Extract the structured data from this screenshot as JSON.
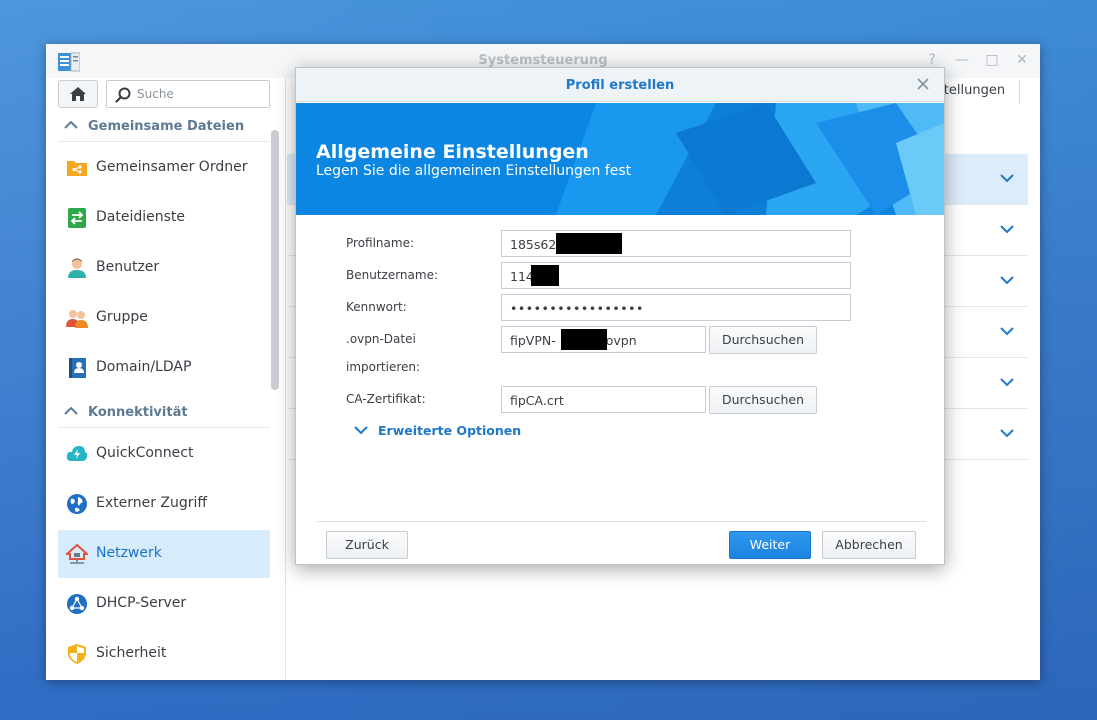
{
  "window": {
    "title": "Systemsteuerung",
    "controls": [
      "?",
      "—",
      "□",
      "✕"
    ]
  },
  "sidebar": {
    "search_placeholder": "Suche",
    "sections": [
      {
        "label": "Gemeinsame Dateien",
        "items": [
          {
            "label": "Gemeinsamer Ordner",
            "icon": "shared-folder-icon"
          },
          {
            "label": "Dateidienste",
            "icon": "file-services-icon"
          },
          {
            "label": "Benutzer",
            "icon": "user-icon"
          },
          {
            "label": "Gruppe",
            "icon": "group-icon"
          },
          {
            "label": "Domain/LDAP",
            "icon": "domain-ldap-icon"
          }
        ]
      },
      {
        "label": "Konnektivität",
        "items": [
          {
            "label": "QuickConnect",
            "icon": "quickconnect-icon"
          },
          {
            "label": "Externer Zugriff",
            "icon": "external-access-icon"
          },
          {
            "label": "Netzwerk",
            "icon": "network-icon",
            "active": true
          },
          {
            "label": "DHCP-Server",
            "icon": "dhcp-server-icon"
          },
          {
            "label": "Sicherheit",
            "icon": "security-icon"
          }
        ]
      }
    ]
  },
  "content": {
    "tab_partial": "stellungen"
  },
  "dialog": {
    "title": "Profil erstellen",
    "banner_title": "Allgemeine Einstellungen",
    "banner_subtitle": "Legen Sie die allgemeinen Einstellungen fest",
    "fields": {
      "profile_name": {
        "label": "Profilname:",
        "value": "185s62"
      },
      "username": {
        "label": "Benutzername:",
        "value": "114"
      },
      "password": {
        "label": "Kennwort:",
        "value": "•••••••••••••••••"
      },
      "ovpn": {
        "label_line1": ".ovpn-Datei",
        "label_line2": "importieren:",
        "value_prefix": "fipVPN-",
        "value_suffix": ".ovpn",
        "browse": "Durchsuchen"
      },
      "ca": {
        "label": "CA-Zertifikat:",
        "value": "fipCA.crt",
        "browse": "Durchsuchen"
      }
    },
    "advanced_label": "Erweiterte Optionen",
    "buttons": {
      "back": "Zurück",
      "next": "Weiter",
      "cancel": "Abbrechen"
    }
  },
  "colors": {
    "accent": "#1f78c8",
    "banner": "#0f8de8",
    "active_bg": "#d6ebfb"
  }
}
